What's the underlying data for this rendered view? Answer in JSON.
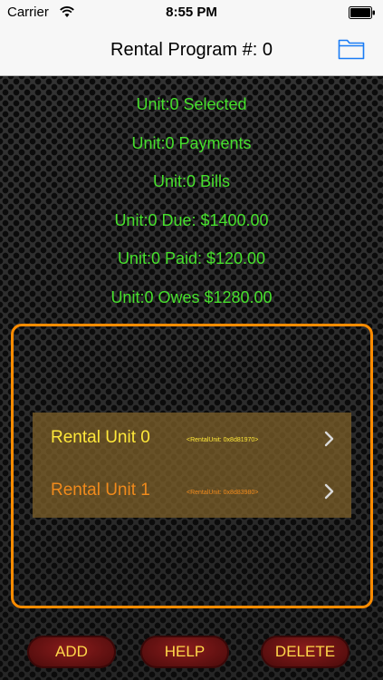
{
  "status_bar": {
    "carrier": "Carrier",
    "time": "8:55 PM"
  },
  "nav": {
    "title": "Rental Program #: 0",
    "folder_icon": "folder-icon"
  },
  "summary": {
    "selected": "Unit:0 Selected",
    "payments": "Unit:0 Payments",
    "bills": "Unit:0 Bills",
    "due": "Unit:0 Due: $1400.00",
    "paid": "Unit:0 Paid: $120.00",
    "owes": "Unit:0 Owes $1280.00"
  },
  "units": [
    {
      "label": "Rental Unit 0",
      "sub": "<RentalUnit: 0x8d81970>"
    },
    {
      "label": "Rental Unit 1",
      "sub": "<RentalUnit: 0x8d83980>"
    }
  ],
  "buttons": {
    "add": "ADD",
    "help": "HELP",
    "delete": "DELETE"
  },
  "colors": {
    "summary_text": "#46e02c",
    "panel_border": "#ff8c00",
    "button_text": "#ffd84a",
    "button_fill": "#6b1414"
  }
}
